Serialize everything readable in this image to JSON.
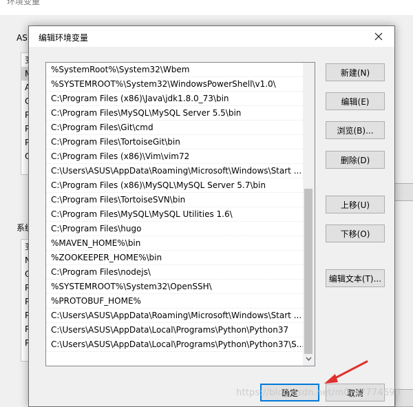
{
  "background_window": {
    "title": "环境变量",
    "user_group_title": "ASU",
    "system_group_title": "系统",
    "user_list": [
      "变",
      "M",
      "AL",
      "Or",
      "Pa",
      "PA",
      "PT",
      "Q5"
    ],
    "system_list": [
      "变",
      "NU",
      "OS",
      "Pa",
      "PA",
      "PR",
      "PR",
      "PR"
    ]
  },
  "dialog": {
    "title": "编辑环境变量",
    "paths": [
      "%SystemRoot%\\System32\\Wbem",
      "%SYSTEMROOT%\\System32\\WindowsPowerShell\\v1.0\\",
      "C:\\Program Files (x86)\\Java\\jdk1.8.0_73\\bin",
      "C:\\Program Files\\MySQL\\MySQL Server 5.5\\bin",
      "C:\\Program Files\\Git\\cmd",
      "C:\\Program Files\\TortoiseGit\\bin",
      "C:\\Program Files (x86)\\Vim\\vim72",
      "C:\\Users\\ASUS\\AppData\\Roaming\\Microsoft\\Windows\\Start ...",
      "C:\\Program Files (x86)\\MySQL\\MySQL Server 5.7\\bin",
      "C:\\Program Files\\TortoiseSVN\\bin",
      "C:\\Program Files\\MySQL\\MySQL Utilities 1.6\\",
      "C:\\Program Files\\hugo",
      "%MAVEN_HOME%\\bin",
      "%ZOOKEEPER_HOME%\\bin",
      "C:\\Program Files\\nodejs\\",
      "%SYSTEMROOT%\\System32\\OpenSSH\\",
      "%PROTOBUF_HOME%",
      "C:\\Users\\ASUS\\AppData\\Roaming\\Microsoft\\Windows\\Start ...",
      "C:\\Users\\ASUS\\AppData\\Local\\Programs\\Python\\Python37",
      "C:\\Users\\ASUS\\AppData\\Local\\Programs\\Python\\Python37\\S..."
    ],
    "buttons": {
      "new": "新建(N)",
      "edit": "编辑(E)",
      "browse": "浏览(B)...",
      "delete": "删除(D)",
      "move_up": "上移(U)",
      "move_down": "下移(O)",
      "edit_text": "编辑文本(T)...",
      "ok": "确定",
      "cancel": "取消"
    }
  },
  "watermark": "https://blog.csdn.net/m0_37774696",
  "colors": {
    "ok_focus_border": "#0078d7",
    "annotation_arrow": "#e0302c"
  }
}
